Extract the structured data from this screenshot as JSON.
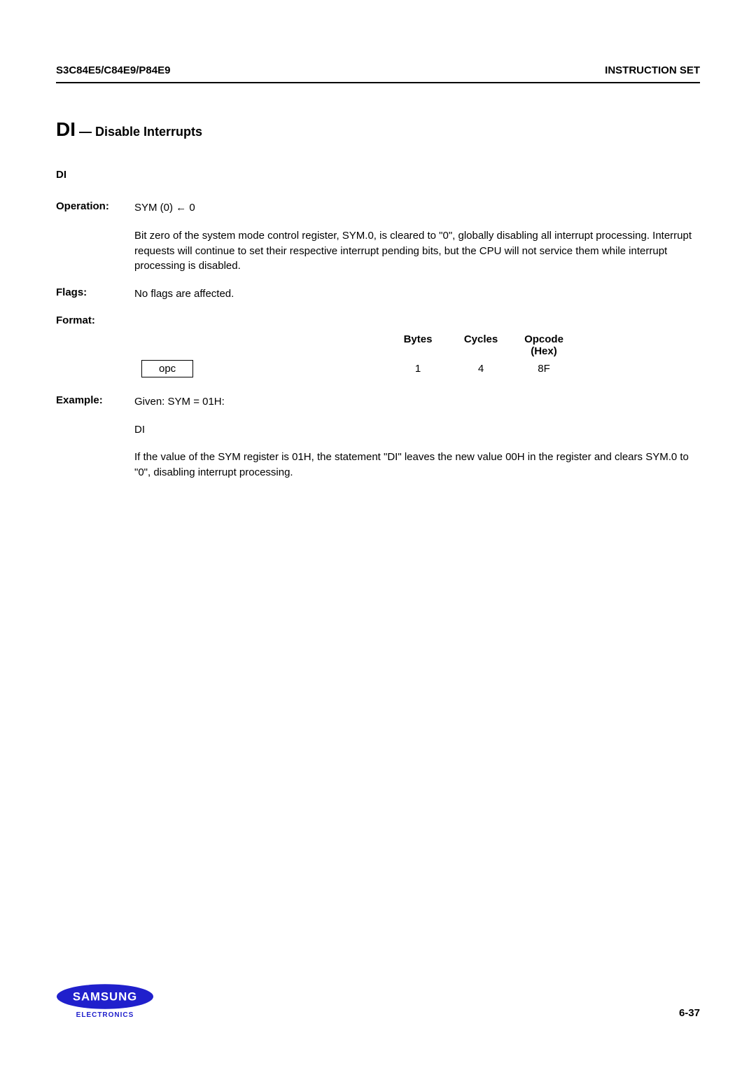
{
  "header": {
    "left": "S3C84E5/C84E9/P84E9",
    "right": "INSTRUCTION SET"
  },
  "title": {
    "mnemonic": "DI",
    "separator": " — ",
    "description": "Disable Interrupts"
  },
  "mnemonic_line": "DI",
  "operation": {
    "label": "Operation:",
    "expression": "SYM (0)  ←  0",
    "description": "Bit zero of the system mode control register, SYM.0, is cleared to \"0\", globally disabling all interrupt processing. Interrupt requests will continue to set their respective interrupt pending bits, but the CPU will not service them while interrupt processing is disabled."
  },
  "flags": {
    "label": "Flags:",
    "text": "No flags are affected."
  },
  "format": {
    "label": "Format:",
    "headers": {
      "bytes": "Bytes",
      "cycles": "Cycles",
      "opcode": "Opcode",
      "opcode_sub": "(Hex)"
    },
    "row": {
      "opc": "opc",
      "bytes": "1",
      "cycles": "4",
      "opcode": "8F"
    }
  },
  "example": {
    "label": "Example:",
    "given": "Given:   SYM  =  01H:",
    "instruction": "DI",
    "description": "If the value of the SYM register is 01H, the statement \"DI\" leaves the new value 00H in the register and clears SYM.0 to \"0\", disabling interrupt processing."
  },
  "footer": {
    "electronics": "ELECTRONICS",
    "page": "6-37"
  }
}
